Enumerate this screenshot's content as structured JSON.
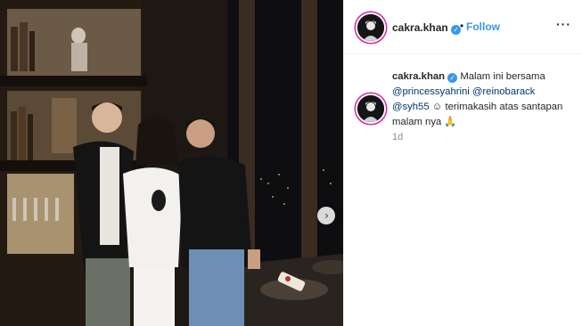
{
  "post": {
    "username": "cakra.khan",
    "verified_glyph": "✓",
    "separator": "•",
    "follow_label": "Follow",
    "more_glyph": "···",
    "caption": {
      "username": "cakra.khan",
      "text_before": " Malam ini bersama ",
      "mention_1": "@princessyahrini",
      "mention_2": "@reinobarack",
      "mention_3": "@syh55",
      "emoji_smile": "☺",
      "text_after": " terimakasih atas santapan malam nya ",
      "emoji_pray": "🙏"
    },
    "timestamp": "1d"
  },
  "carousel": {
    "next_glyph": "›"
  },
  "icons": {
    "avatar": "profile-avatar-icon",
    "next": "chevron-right-icon",
    "verified": "verified-badge-icon"
  },
  "colors": {
    "accent": "#3897f0",
    "mention": "#00376b",
    "muted": "#8e8e8e",
    "avatar_ring": "#d6249f"
  }
}
